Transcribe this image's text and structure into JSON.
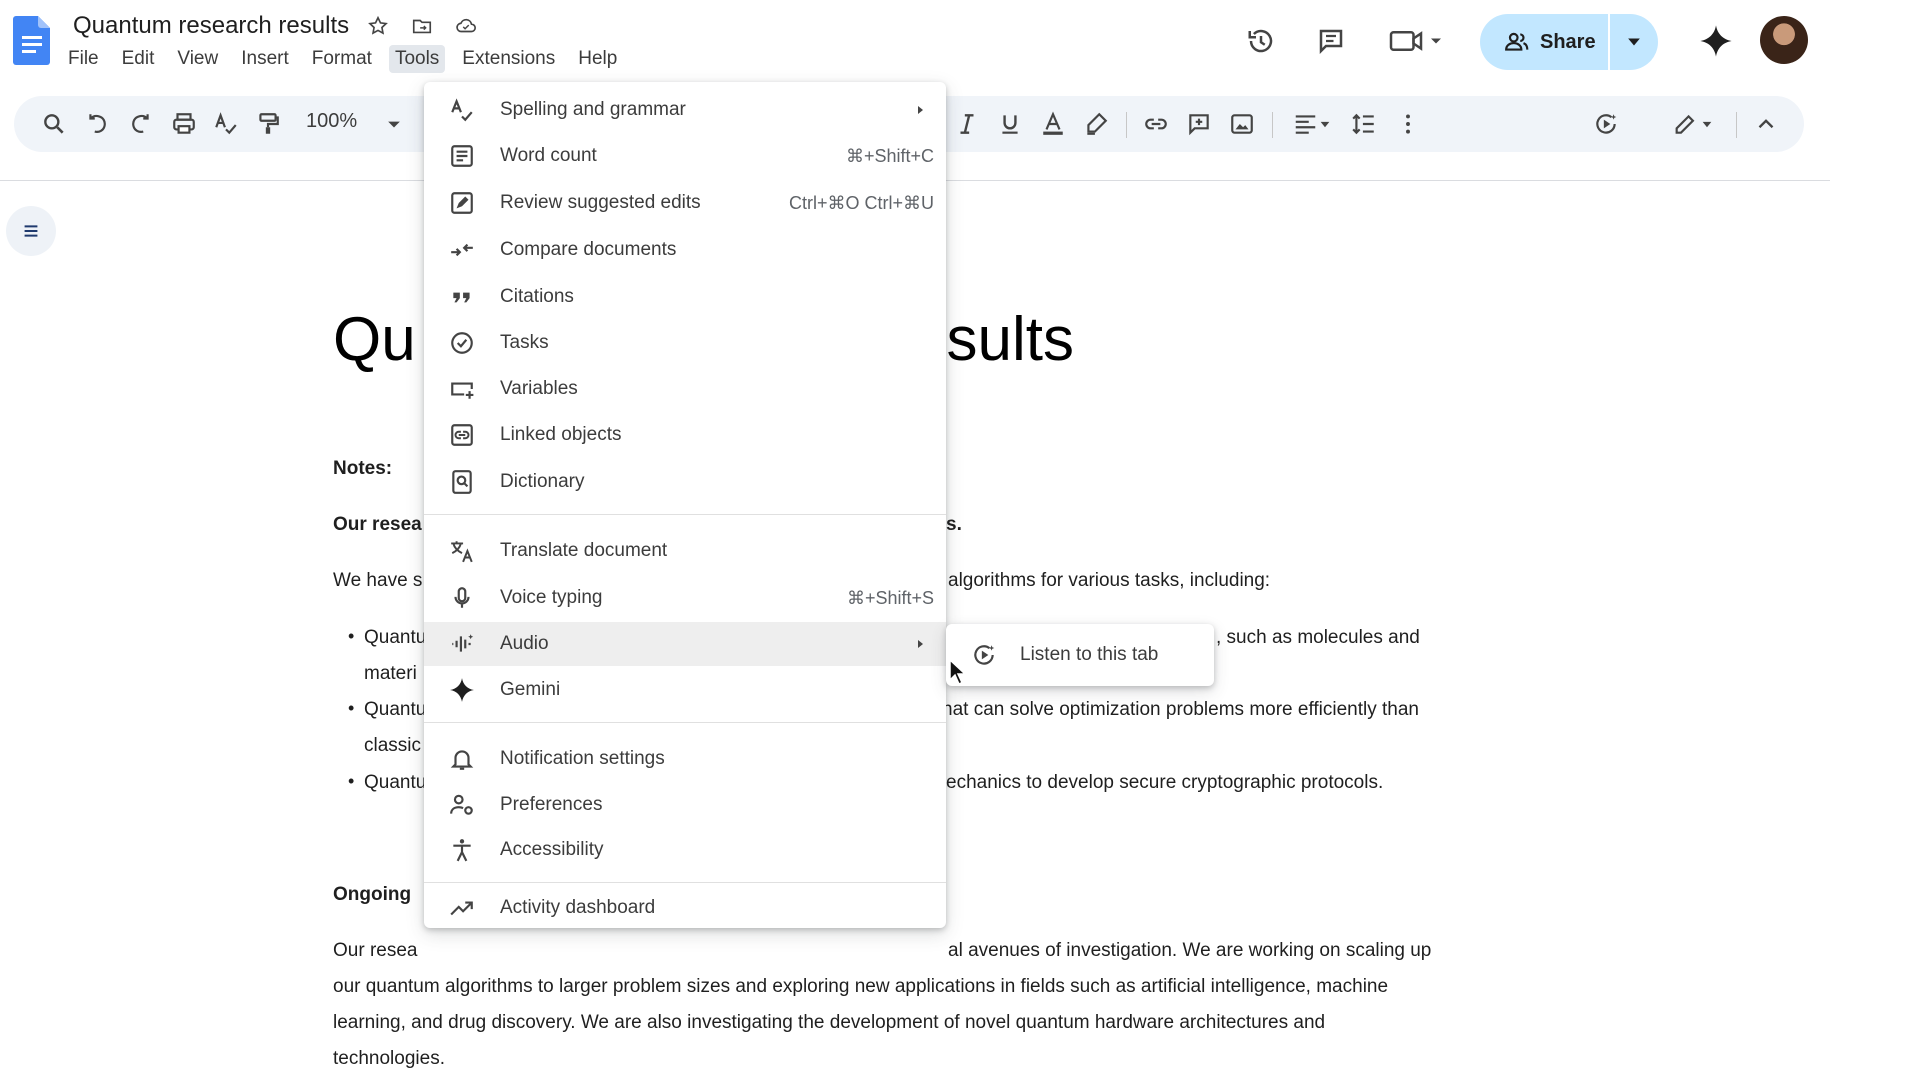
{
  "document": {
    "title": "Quantum research results",
    "heading_left": "Qu",
    "heading_right": "esults",
    "notes_label": "Notes:",
    "bold_line_left": "Our resea",
    "bold_line_right": "s.",
    "intro_left": "We have s",
    "intro_right": "algorithms for various tasks, including:",
    "bullets": [
      {
        "line1_left": "Quantu",
        "line1_right": ", such as molecules and",
        "line2_left": "materi"
      },
      {
        "line1_left": "Quantu",
        "line1_right": "hat can solve optimization problems more efficiently than",
        "line2_left": "classic"
      },
      {
        "line1_left": "Quantu",
        "line1_right": "echanics to develop secure cryptographic protocols."
      }
    ],
    "ongoing_label": "Ongoing",
    "paragraph_line1_left": "Our resea",
    "paragraph_line1_right": "al avenues of investigation. We are working on scaling up",
    "paragraph_line2": "our quantum algorithms to larger problem sizes and exploring new applications in fields such as artificial intelligence, machine",
    "paragraph_line3": "learning, and drug discovery. We are also investigating the development of novel quantum hardware architectures and",
    "paragraph_line4": "technologies."
  },
  "menubar": [
    "File",
    "Edit",
    "View",
    "Insert",
    "Format",
    "Tools",
    "Extensions",
    "Help"
  ],
  "toolbar": {
    "zoom": "100%"
  },
  "header": {
    "share_label": "Share"
  },
  "tools_menu": {
    "items": [
      {
        "label": "Spelling and grammar",
        "shortcut": "",
        "icon": "spellcheck-icon",
        "submenu": true
      },
      {
        "label": "Word count",
        "shortcut": "⌘+Shift+C",
        "icon": "word-count-icon"
      },
      {
        "label": "Review suggested edits",
        "shortcut": "Ctrl+⌘O Ctrl+⌘U",
        "icon": "review-edits-icon"
      },
      {
        "label": "Compare documents",
        "shortcut": "",
        "icon": "compare-icon"
      },
      {
        "label": "Citations",
        "shortcut": "",
        "icon": "quote-icon"
      },
      {
        "label": "Tasks",
        "shortcut": "",
        "icon": "task-check-icon"
      },
      {
        "label": "Variables",
        "shortcut": "",
        "icon": "variables-icon"
      },
      {
        "label": "Linked objects",
        "shortcut": "",
        "icon": "linked-objects-icon"
      },
      {
        "label": "Dictionary",
        "shortcut": "",
        "icon": "dictionary-icon"
      },
      {
        "label": "Translate document",
        "shortcut": "",
        "icon": "translate-icon"
      },
      {
        "label": "Voice typing",
        "shortcut": "⌘+Shift+S",
        "icon": "microphone-icon"
      },
      {
        "label": "Audio",
        "shortcut": "",
        "icon": "audio-icon",
        "submenu": true
      },
      {
        "label": "Gemini",
        "shortcut": "",
        "icon": "gemini-icon"
      },
      {
        "label": "Notification settings",
        "shortcut": "",
        "icon": "bell-icon"
      },
      {
        "label": "Preferences",
        "shortcut": "",
        "icon": "preferences-icon"
      },
      {
        "label": "Accessibility",
        "shortcut": "",
        "icon": "accessibility-icon"
      },
      {
        "label": "Activity dashboard",
        "shortcut": "",
        "icon": "trending-icon"
      }
    ],
    "highlighted": "Audio"
  },
  "audio_submenu": {
    "listen_label": "Listen to this tab",
    "icon": "listen-icon"
  },
  "colors": {
    "accent": "#1a73e8",
    "share_bg": "#c2e7ff",
    "toolbar_bg": "#f0f4f9"
  }
}
